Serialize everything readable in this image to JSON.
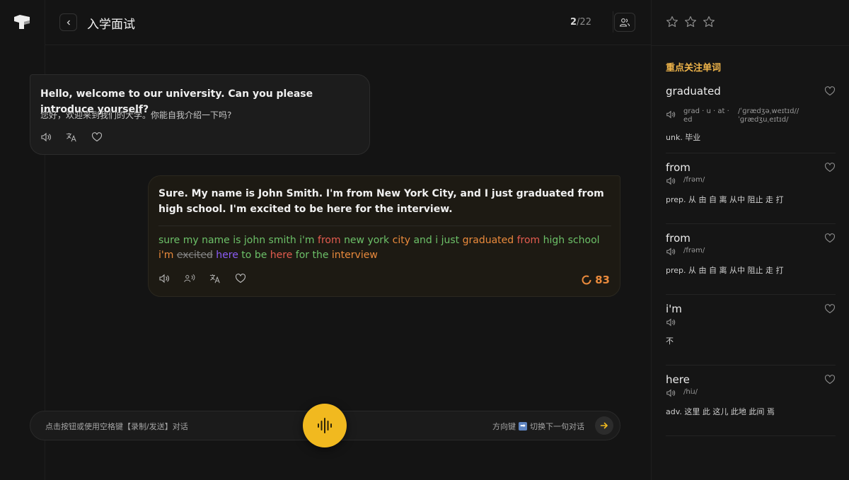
{
  "header": {
    "title": "入学面试",
    "progress_current": "2",
    "progress_total": "/22"
  },
  "dialog": {
    "q1": {
      "en": "Hello, welcome to our university. Can you please introduce yourself?",
      "zh": "您好，欢迎来到我们的大学。你能自我介绍一下吗?"
    },
    "a1": {
      "en": "Sure. My name is John Smith. I'm from New York City, and I just graduated from high school. I'm excited to be here for the interview.",
      "recognized": [
        {
          "w": "sure",
          "s": "good"
        },
        {
          "w": "my",
          "s": "good"
        },
        {
          "w": "name",
          "s": "good"
        },
        {
          "w": "is",
          "s": "good"
        },
        {
          "w": "john",
          "s": "good"
        },
        {
          "w": "smith",
          "s": "good"
        },
        {
          "w": "i'm",
          "s": "good"
        },
        {
          "w": "from",
          "s": "bad"
        },
        {
          "w": "new",
          "s": "good"
        },
        {
          "w": "york",
          "s": "good"
        },
        {
          "w": "city",
          "s": "mid"
        },
        {
          "w": "and",
          "s": "good"
        },
        {
          "w": "i",
          "s": "good"
        },
        {
          "w": "just",
          "s": "good"
        },
        {
          "w": "graduated",
          "s": "mid"
        },
        {
          "w": "from",
          "s": "bad"
        },
        {
          "w": "high",
          "s": "good"
        },
        {
          "w": "school",
          "s": "good"
        },
        {
          "w": "i'm",
          "s": "mid"
        },
        {
          "w": "excited",
          "s": "miss"
        },
        {
          "w": "here",
          "s": "ins"
        },
        {
          "w": "to",
          "s": "good"
        },
        {
          "w": "be",
          "s": "good"
        },
        {
          "w": "here",
          "s": "bad"
        },
        {
          "w": "for",
          "s": "good"
        },
        {
          "w": "the",
          "s": "good"
        },
        {
          "w": "interview",
          "s": "mid"
        }
      ],
      "score": "83"
    }
  },
  "bottom_bar": {
    "hint_left": "点击按钮或使用空格键【录制/发送】对话",
    "hint_right_prefix": "方向键",
    "hint_right_key": "➡",
    "hint_right_suffix": "切换下一句对话"
  },
  "panel": {
    "rating_stars": 3,
    "title": "重点关注单词",
    "words": [
      {
        "word": "graduated",
        "syllables": "grad · u · at · ed",
        "phonetic": "/ˈɡrædʒəˌweɪtɪd//ˈɡrædʒuˌeɪtɪd/",
        "definition": "unk. 毕业"
      },
      {
        "word": "from",
        "syllables": "",
        "phonetic": "/frəm/",
        "definition": "prep. 从 由 自 离 从中 阻止 走 打"
      },
      {
        "word": "from",
        "syllables": "",
        "phonetic": "/frəm/",
        "definition": "prep. 从 由 自 离 从中 阻止 走 打"
      },
      {
        "word": "i'm",
        "syllables": "",
        "phonetic": "",
        "definition": "不"
      },
      {
        "word": "here",
        "syllables": "",
        "phonetic": "/hiɹ/",
        "definition": "adv. 这里 此 这儿 此地 此间 焉"
      }
    ]
  },
  "colors": {
    "accent": "#f1b91f",
    "good": "#6cc068",
    "bad": "#e35c4f",
    "mid": "#ea8a3c",
    "inserted": "#8b5cf6",
    "panel_title": "#f0b54a"
  }
}
